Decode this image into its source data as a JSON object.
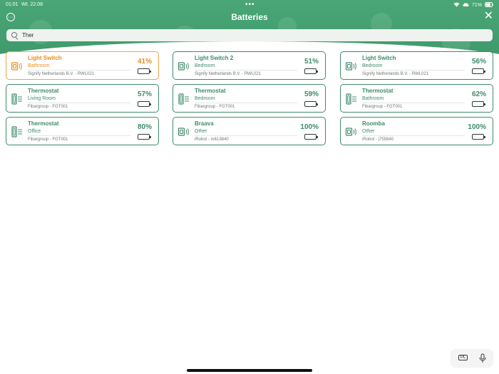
{
  "status_bar": {
    "time": "01:01",
    "date": "Wt. 22.08",
    "battery": "71%"
  },
  "header": {
    "title": "Batteries"
  },
  "search": {
    "value": "Ther",
    "placeholder": ""
  },
  "colors": {
    "accent": "#3d8c68",
    "header_bg": "#4aa676",
    "warning": "#e98d1e"
  },
  "devices": [
    {
      "name": "Light Switch",
      "room": "Bathroom",
      "maker": "Signify Netherlands B.V. - RWL021",
      "battery": "41%",
      "level": 0.41,
      "icon": "light-switch-icon",
      "warning": true
    },
    {
      "name": "Light Switch 2",
      "room": "Bedroom",
      "maker": "Signify Netherlands B.V. - RWL021",
      "battery": "51%",
      "level": 0.51,
      "icon": "light-switch-icon",
      "warning": false
    },
    {
      "name": "Light Switch",
      "room": "Bedroom",
      "maker": "Signify Netherlands B.V. - RWL021",
      "battery": "56%",
      "level": 0.56,
      "icon": "light-switch-icon",
      "warning": false
    },
    {
      "name": "Thermostat",
      "room": "Living Room",
      "maker": "Fibargroup - FGT001",
      "battery": "57%",
      "level": 0.57,
      "icon": "thermostat-icon",
      "warning": false
    },
    {
      "name": "Thermostat",
      "room": "Bedroom",
      "maker": "Fibargroup - FGT001",
      "battery": "59%",
      "level": 0.59,
      "icon": "thermostat-icon",
      "warning": false
    },
    {
      "name": "Thermostat",
      "room": "Bathroom",
      "maker": "Fibargroup - FGT001",
      "battery": "62%",
      "level": 0.62,
      "icon": "thermostat-icon",
      "warning": false
    },
    {
      "name": "Thermostat",
      "room": "Office",
      "maker": "Fibargroup - FGT001",
      "battery": "80%",
      "level": 0.8,
      "icon": "thermostat-icon",
      "warning": false
    },
    {
      "name": "Braava",
      "room": "Other",
      "maker": "iRobot - m613840",
      "battery": "100%",
      "level": 1.0,
      "icon": "light-switch-icon",
      "warning": false
    },
    {
      "name": "Roomba",
      "room": "Other",
      "maker": "iRobot - j755840",
      "battery": "100%",
      "level": 1.0,
      "icon": "light-switch-icon",
      "warning": false
    }
  ],
  "keyboard": {
    "language": "PL"
  }
}
